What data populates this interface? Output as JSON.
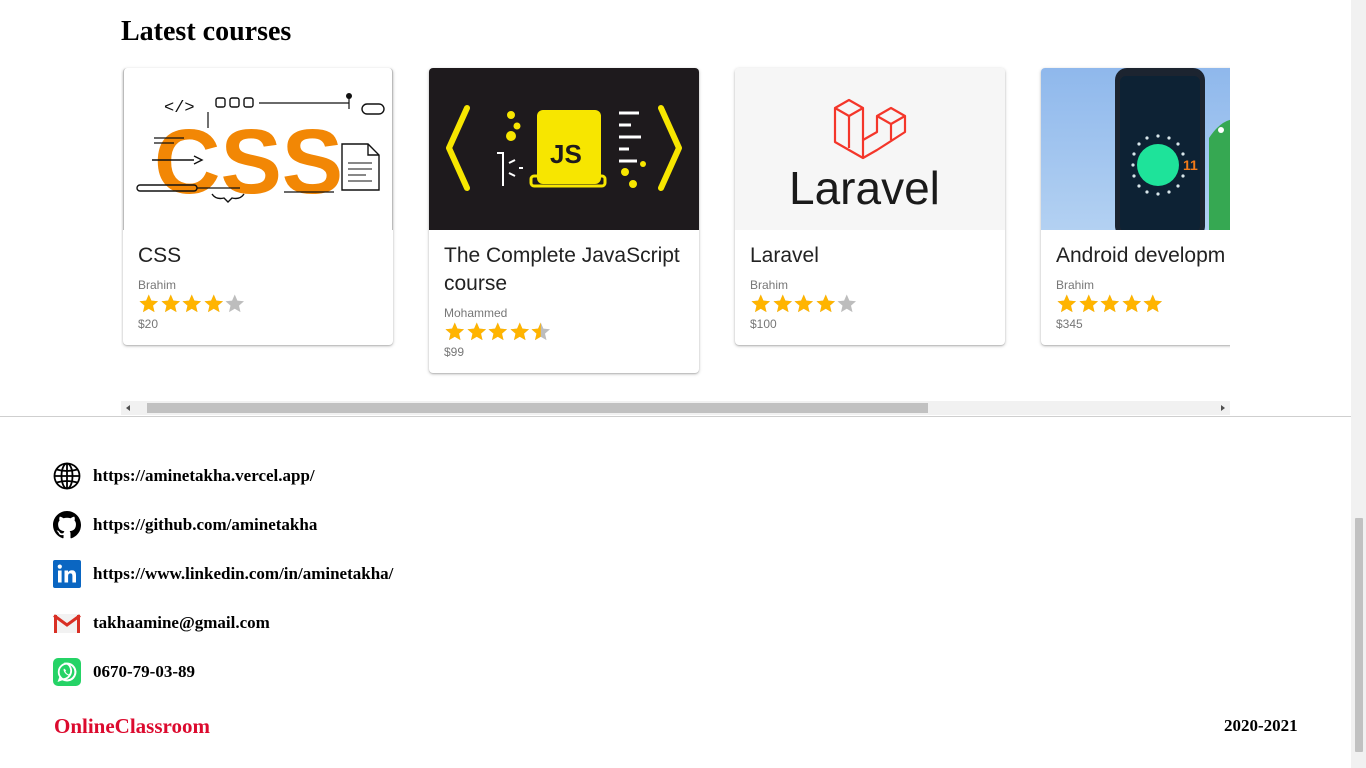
{
  "section": {
    "title": "Latest courses"
  },
  "courses": [
    {
      "title": "CSS",
      "author": "Brahim",
      "rating": 4,
      "price": "$20",
      "image_text": "CSS"
    },
    {
      "title": "The Complete JavaScript course",
      "author": "Mohammed",
      "rating": 4.5,
      "price": "$99",
      "image_text": "JS"
    },
    {
      "title": "Laravel",
      "author": "Brahim",
      "rating": 4,
      "price": "$100",
      "image_text": "Laravel"
    },
    {
      "title": "Android developm",
      "author": "Brahim",
      "rating": 5,
      "price": "$345",
      "image_text": "11"
    }
  ],
  "contacts": [
    {
      "icon": "globe-icon",
      "text": "https://aminetakha.vercel.app/"
    },
    {
      "icon": "github-icon",
      "text": "https://github.com/aminetakha"
    },
    {
      "icon": "linkedin-icon",
      "text": "https://www.linkedin.com/in/aminetakha/"
    },
    {
      "icon": "gmail-icon",
      "text": "takhaamine@gmail.com"
    },
    {
      "icon": "whatsapp-icon",
      "text": "0670-79-03-89"
    }
  ],
  "footer": {
    "brand": "OnlineClassroom",
    "year": "2020-2021"
  },
  "colors": {
    "star": "#ffb400",
    "star_empty": "#bdbdbd",
    "brand": "#dc0a2e",
    "js_bg": "#1e1a1d",
    "js_yellow": "#f7e600",
    "laravel_red": "#f4362a",
    "css_orange": "#f28705"
  }
}
